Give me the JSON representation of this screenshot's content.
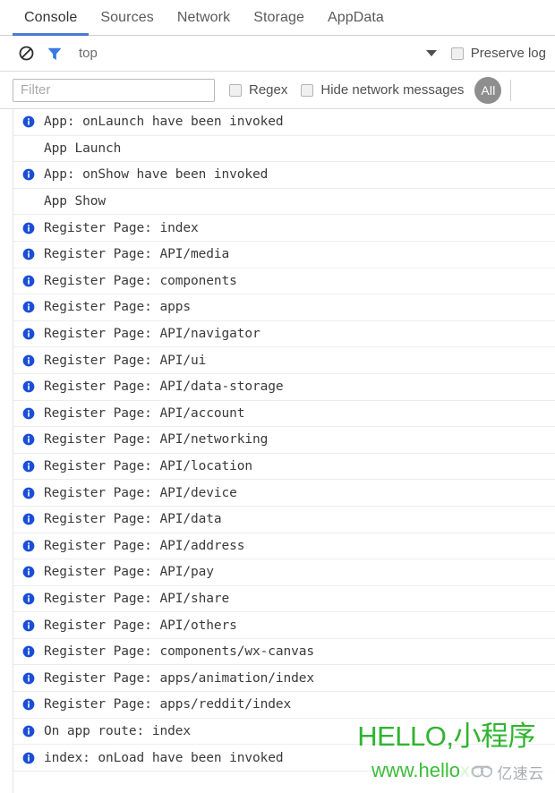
{
  "tabs": [
    {
      "label": "Console",
      "active": true
    },
    {
      "label": "Sources",
      "active": false
    },
    {
      "label": "Network",
      "active": false
    },
    {
      "label": "Storage",
      "active": false
    },
    {
      "label": "AppData",
      "active": false
    }
  ],
  "toolbar": {
    "clear_icon": "clear-console-icon",
    "filter_icon": "funnel-filter-icon",
    "context": "top",
    "context_dropdown_icon": "chevron-down-icon",
    "preserve_log_label": "Preserve log",
    "preserve_log_checked": false
  },
  "filterbar": {
    "filter_placeholder": "Filter",
    "filter_value": "",
    "regex_label": "Regex",
    "regex_checked": false,
    "hide_network_label": "Hide network messages",
    "hide_network_checked": false,
    "level_pill": "All"
  },
  "colors": {
    "accent": "#4a79d4",
    "info_icon": "#1a4ed8",
    "pill_bg": "#8e8e8e",
    "watermark_green": "#2fb42f",
    "log_text": "#3a3a3a"
  },
  "console": {
    "rows": [
      {
        "icon": "info-icon",
        "text": "App: onLaunch have been invoked"
      },
      {
        "icon": "none",
        "text": "App Launch"
      },
      {
        "icon": "info-icon",
        "text": "App: onShow have been invoked"
      },
      {
        "icon": "none",
        "text": "App Show"
      },
      {
        "icon": "info-icon",
        "text": "Register Page: index"
      },
      {
        "icon": "info-icon",
        "text": "Register Page: API/media"
      },
      {
        "icon": "info-icon",
        "text": "Register Page: components"
      },
      {
        "icon": "info-icon",
        "text": "Register Page: apps"
      },
      {
        "icon": "info-icon",
        "text": "Register Page: API/navigator"
      },
      {
        "icon": "info-icon",
        "text": "Register Page: API/ui"
      },
      {
        "icon": "info-icon",
        "text": "Register Page: API/data-storage"
      },
      {
        "icon": "info-icon",
        "text": "Register Page: API/account"
      },
      {
        "icon": "info-icon",
        "text": "Register Page: API/networking"
      },
      {
        "icon": "info-icon",
        "text": "Register Page: API/location"
      },
      {
        "icon": "info-icon",
        "text": "Register Page: API/device"
      },
      {
        "icon": "info-icon",
        "text": "Register Page: API/data"
      },
      {
        "icon": "info-icon",
        "text": "Register Page: API/address"
      },
      {
        "icon": "info-icon",
        "text": "Register Page: API/pay"
      },
      {
        "icon": "info-icon",
        "text": "Register Page: API/share"
      },
      {
        "icon": "info-icon",
        "text": "Register Page: API/others"
      },
      {
        "icon": "info-icon",
        "text": "Register Page: components/wx-canvas"
      },
      {
        "icon": "info-icon",
        "text": "Register Page: apps/animation/index"
      },
      {
        "icon": "info-icon",
        "text": "Register Page: apps/reddit/index"
      },
      {
        "icon": "info-icon",
        "text": "On app route: index"
      },
      {
        "icon": "info-icon",
        "text": "index: onLoad have been invoked"
      }
    ]
  },
  "watermark": {
    "headline": "HELLO,小程序",
    "url": "www.helloxc",
    "logo_text": "亿速云",
    "logo_mark": "cloud-logo-icon"
  }
}
